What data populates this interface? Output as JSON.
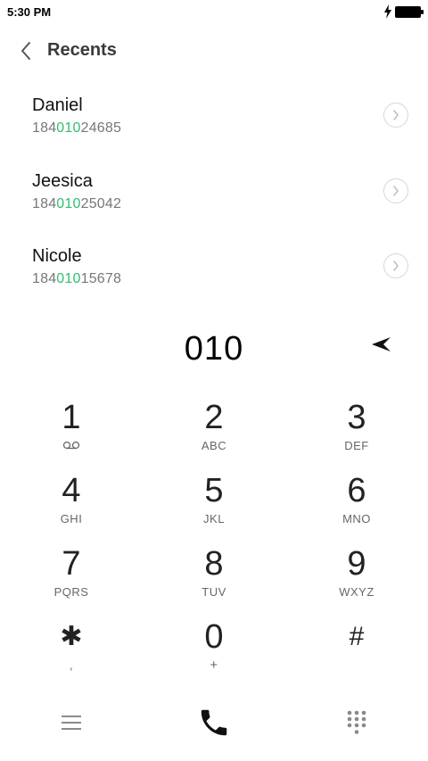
{
  "status_bar": {
    "time": "5:30 PM",
    "icons": [
      "charging-bolt-icon",
      "battery-icon"
    ]
  },
  "header": {
    "title": "Recents",
    "back_icon": "chevron-left-icon"
  },
  "recents": [
    {
      "name": "Daniel",
      "number_prefix": "184",
      "number_match": "010",
      "number_suffix": "24685"
    },
    {
      "name": "Jeesica",
      "number_prefix": "184",
      "number_match": "010",
      "number_suffix": "25042"
    },
    {
      "name": "Nicole",
      "number_prefix": "184",
      "number_match": "010",
      "number_suffix": "15678"
    }
  ],
  "dialer": {
    "input_value": "010",
    "delete_icon": "backspace-arrow-icon"
  },
  "keypad": [
    {
      "digit": "1",
      "letters": ""
    },
    {
      "digit": "2",
      "letters": "ABC"
    },
    {
      "digit": "3",
      "letters": "DEF"
    },
    {
      "digit": "4",
      "letters": "GHI"
    },
    {
      "digit": "5",
      "letters": "JKL"
    },
    {
      "digit": "6",
      "letters": "MNO"
    },
    {
      "digit": "7",
      "letters": "PQRS"
    },
    {
      "digit": "8",
      "letters": "TUV"
    },
    {
      "digit": "9",
      "letters": "WXYZ"
    },
    {
      "digit": "✱",
      "letters": ","
    },
    {
      "digit": "0",
      "letters": "+"
    },
    {
      "digit": "#",
      "letters": ""
    }
  ],
  "bottom_bar": {
    "icons": [
      "menu-icon",
      "phone-icon",
      "dialpad-icon"
    ]
  },
  "colors": {
    "match_highlight": "#2fbf71",
    "text_primary": "#111111",
    "text_secondary": "#777777",
    "icon_gray": "#8a8a8a"
  }
}
